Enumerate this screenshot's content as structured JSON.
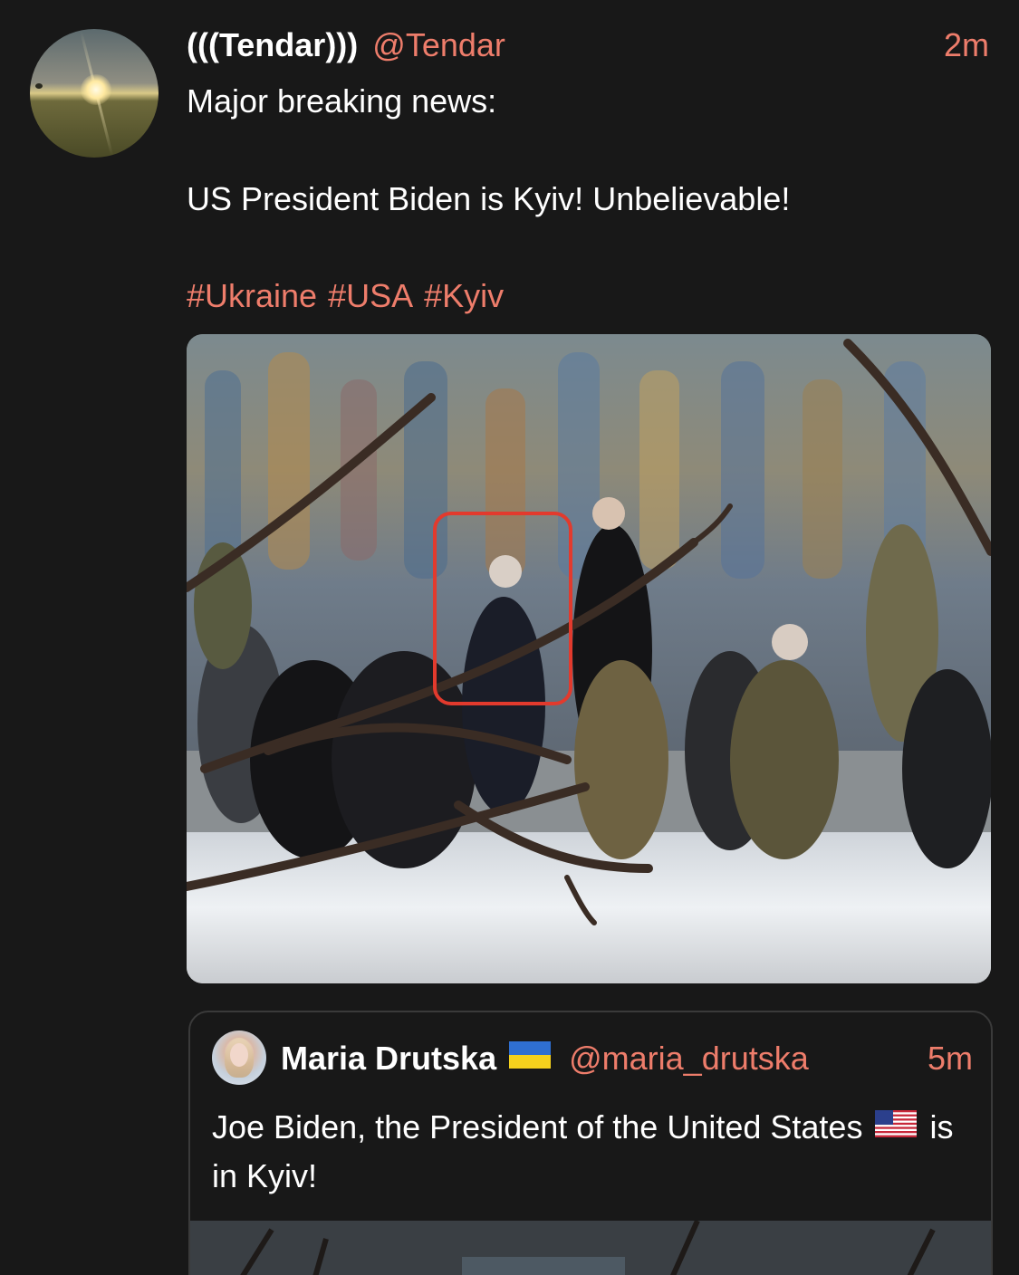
{
  "tweet": {
    "display_name": "(((Tendar)))",
    "handle": "@Tendar",
    "time": "2m",
    "body": {
      "line1": "Major breaking news:",
      "line2": "US President Biden is Kyiv! Unbelievable!"
    },
    "hashtags": [
      "#Ukraine",
      "#USA",
      "#Kyiv"
    ],
    "media": {
      "highlight_color": "#e23a2d"
    }
  },
  "quoted_tweet": {
    "display_name": "Maria Drutska",
    "name_flag": "ukraine-flag-icon",
    "handle": "@maria_drutska",
    "time": "5m",
    "text_before_flag": "Joe Biden, the President of the United States",
    "text_flag": "us-flag-icon",
    "text_after_flag": "is in Kyiv!"
  },
  "colors": {
    "background": "#181818",
    "accent": "#ee7d6b",
    "text": "#ffffff",
    "border": "#3a3a3a"
  }
}
